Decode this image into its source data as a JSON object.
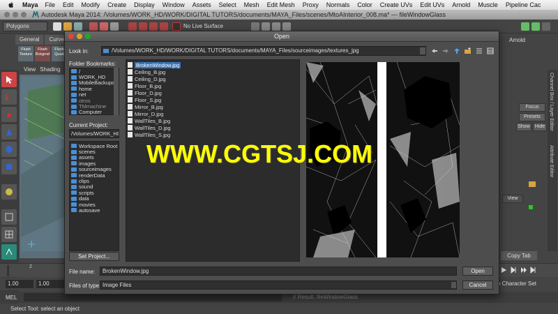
{
  "menubar": {
    "app": "Maya",
    "items": [
      "File",
      "Edit",
      "Modify",
      "Create",
      "Display",
      "Window",
      "Assets",
      "Select",
      "Mesh",
      "Edit Mesh",
      "Proxy",
      "Normals",
      "Color",
      "Create UVs",
      "Edit UVs",
      "Arnold",
      "Muscle",
      "Pipeline Cac"
    ]
  },
  "maya_window": {
    "title": "Autodesk Maya 2014: /Volumes/WORK_HD/WORK/DIGITAL TUTORS/documents/MAYA_Files/scenes/MtoAInterior_008.ma*   ---   fileWindowGlass"
  },
  "toolbar": {
    "mode": "Polygons",
    "live_surface": "No Live Surface",
    "renderer": "Arnold"
  },
  "shelf": {
    "tabs": [
      "General",
      "Curve"
    ],
    "buttons": [
      "Flush Texture",
      "Flush Bckgrnd",
      "Flush Quad"
    ]
  },
  "viewport": {
    "menus": [
      "View",
      "Shading"
    ]
  },
  "right_panel": {
    "focus": "Focus",
    "presets": "Presets",
    "show": "Show",
    "hide": "Hide",
    "view": "View",
    "copy_tab": "Copy Tab",
    "character_set": "o Character Set",
    "tab_channel": "Channel Box / Layer Editor",
    "tab_attribute": "Attribute Editor"
  },
  "timeline": {
    "frame_2": "2",
    "start": "1.00",
    "current": "1.00"
  },
  "mel": {
    "label": "MEL",
    "result": "// Result: fileWindowGlass"
  },
  "help_line": "Select Tool: select an object",
  "dialog": {
    "title": "Open",
    "look_in_label": "Look in:",
    "look_in_path": "/Volumes/WORK_HD/WORK/DIGITAL TUTORS/documents/MAYA_Files/sourceimages/textures_jpg",
    "bookmarks_label": "Folder Bookmarks:",
    "bookmarks": [
      {
        "name": "/",
        "dim": false
      },
      {
        "name": "WORK_HD",
        "dim": false
      },
      {
        "name": "MobileBackups",
        "dim": false
      },
      {
        "name": "home",
        "dim": false
      },
      {
        "name": "net",
        "dim": false
      },
      {
        "name": "otros",
        "dim": true
      },
      {
        "name": "TMmachine",
        "dim": true
      },
      {
        "name": "Computer",
        "dim": false
      },
      {
        "name": "Desktop",
        "dim": false
      }
    ],
    "current_project_label": "Current Project:",
    "current_project": "/Volumes/WORK_HD/WO",
    "project_folders": [
      "Workspace Root",
      "scenes",
      "assets",
      "images",
      "sourceimages",
      "renderData",
      "clips",
      "sound",
      "scripts",
      "data",
      "movies",
      "autosave"
    ],
    "set_project": "Set Project...",
    "files": [
      "BrokenWindow.jpg",
      "Ceiling_B.jpg",
      "Ceiling_D.jpg",
      "Floor_B.jpg",
      "Floor_D.jpg",
      "Floor_S.jpg",
      "Mirror_B.jpg",
      "Mirror_D.jpg",
      "WallTiles_B.jpg",
      "WallTiles_D.jpg",
      "WallTiles_S.jpg"
    ],
    "selected_file_index": 0,
    "file_name_label": "File name:",
    "file_name": "BrokenWindow.jpg",
    "open_button": "Open",
    "files_of_type_label": "Files of type:",
    "files_of_type": "Image Files",
    "cancel_button": "Cancel"
  },
  "watermark": "WWW.CGTSJ.COM"
}
